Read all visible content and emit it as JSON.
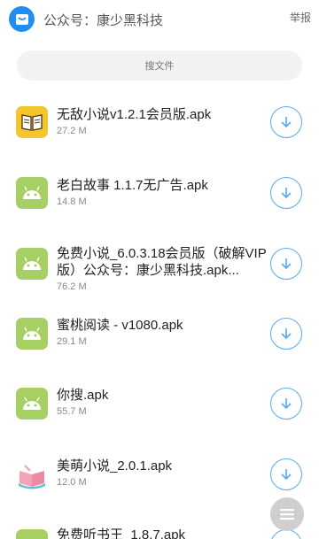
{
  "header": {
    "title": "公众号：康少黑科技",
    "report_label": "举报",
    "logo_icon": "bag-icon"
  },
  "search": {
    "label": "搜文件"
  },
  "files": [
    {
      "name": "无敌小说v1.2.1会员版.apk",
      "size": "27.2 M",
      "icon": "book-icon"
    },
    {
      "name": "老白故事 1.1.7无广告.apk",
      "size": "14.8 M",
      "icon": "android-icon"
    },
    {
      "name": "免费小说_6.0.3.18会员版（破解VIP版）公众号：康少黑科技.apk...",
      "size": "76.2 M",
      "icon": "android-icon"
    },
    {
      "name": "蜜桃阅读 - v1080.apk",
      "size": "29.1 M",
      "icon": "android-icon"
    },
    {
      "name": "你搜.apk",
      "size": "55.7 M",
      "icon": "android-icon"
    },
    {
      "name": "美萌小说_2.0.1.apk",
      "size": "12.0 M",
      "icon": "open-book-icon"
    },
    {
      "name": "免费听书王_1.8.7.apk",
      "size": "",
      "icon": "android-icon"
    }
  ],
  "colors": {
    "accent": "#1e8ef1",
    "download_blue": "#55aaf0",
    "android_green": "#a6cf64"
  }
}
